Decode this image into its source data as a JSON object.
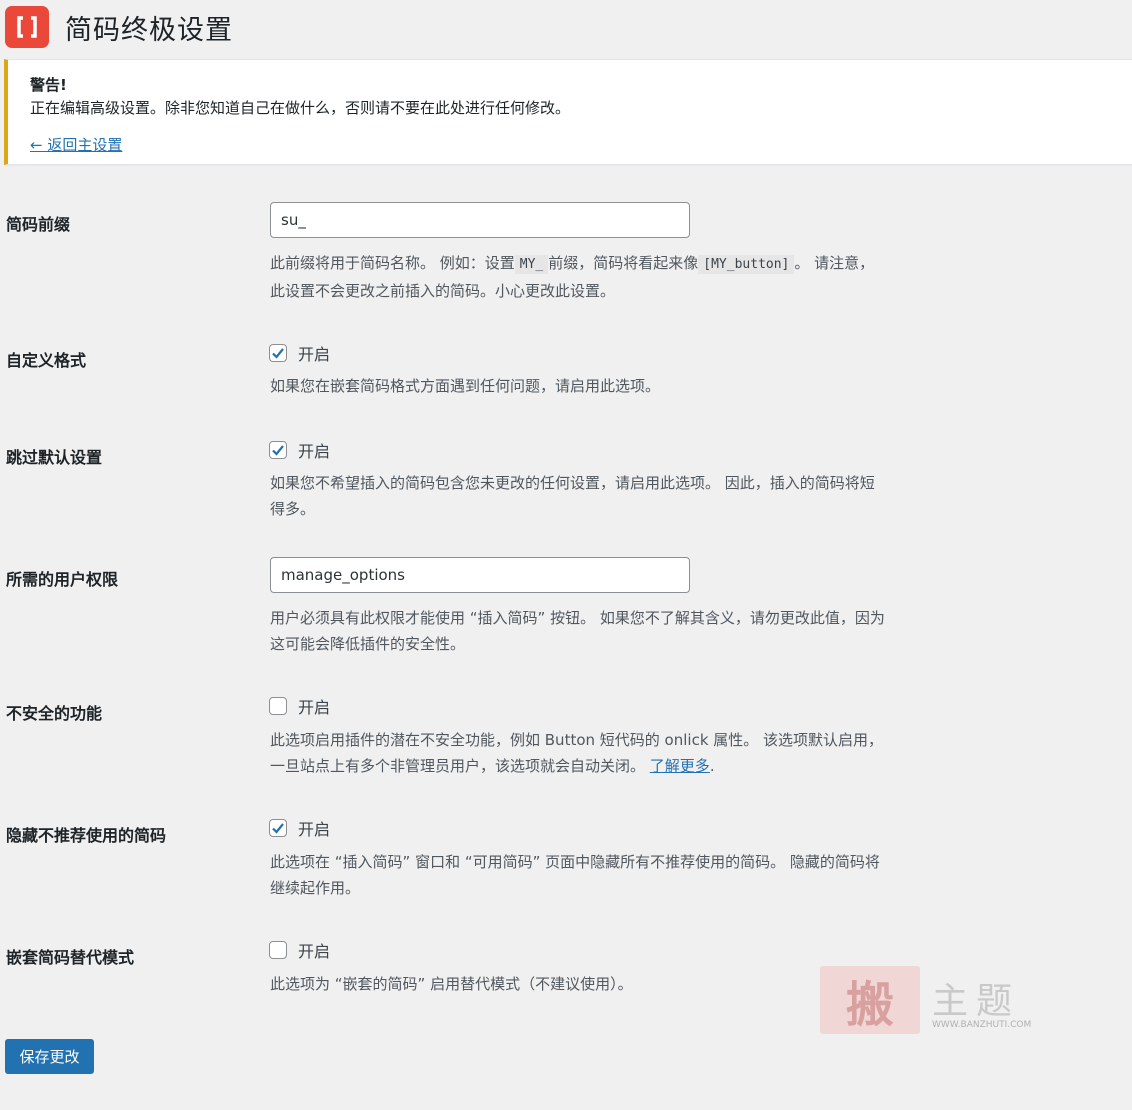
{
  "page": {
    "title": "简码终极设置"
  },
  "notice": {
    "title": "警告!",
    "text": "正在编辑高级设置。除非您知道自己在做什么，否则请不要在此处进行任何修改。",
    "back_link": "← 返回主设置"
  },
  "settings": {
    "prefix": {
      "label": "简码前缀",
      "value": "su_",
      "desc_1": "此前缀将用于简码名称。 例如：设置",
      "code_1": "MY_",
      "desc_2": "前缀，简码将看起来像",
      "code_2": "[MY_button]",
      "desc_3": "。 请注意，",
      "desc_line2": "此设置不会更改之前插入的简码。小心更改此设置。"
    },
    "custom_formatting": {
      "label": "自定义格式",
      "checked": true,
      "check_label": "开启",
      "desc": "如果您在嵌套简码格式方面遇到任何问题，请启用此选项。"
    },
    "skip_defaults": {
      "label": "跳过默认设置",
      "checked": true,
      "check_label": "开启",
      "desc_line1": "如果您不希望插入的简码包含您未更改的任何设置，请启用此选项。 因此，插入的简码将短",
      "desc_line2": "得多。"
    },
    "capability": {
      "label": "所需的用户权限",
      "value": "manage_options",
      "desc_line1": "用户必须具有此权限才能使用 “插入简码” 按钮。 如果您不了解其含义，请勿更改此值，因为",
      "desc_line2": "这可能会降低插件的安全性。"
    },
    "unsafe_features": {
      "label": "不安全的功能",
      "checked": false,
      "check_label": "开启",
      "desc_line1": "此选项启用插件的潜在不安全功能，例如 Button 短代码的 onlick 属性。 该选项默认启用，",
      "desc_line2": "一旦站点上有多个非管理员用户，该选项就会自动关闭。",
      "learn_more": "了解更多",
      "period": "."
    },
    "hide_deprecated": {
      "label": "隐藏不推荐使用的简码",
      "checked": true,
      "check_label": "开启",
      "desc_line1": "此选项在 “插入简码” 窗口和 “可用简码” 页面中隐藏所有不推荐使用的简码。 隐藏的简码将",
      "desc_line2": "继续起作用。"
    },
    "nested_alt_mode": {
      "label": "嵌套简码替代模式",
      "checked": false,
      "check_label": "开启",
      "desc": "此选项为 “嵌套的简码” 启用替代模式（不建议使用）。"
    }
  },
  "save_button": "保存更改",
  "watermark": {
    "seal": "搬",
    "text": "主题",
    "url": "WWW.BANZHUTI.COM"
  },
  "colors": {
    "primary": "#2271b1",
    "warning_border": "#dba617",
    "logo": "#ea4838"
  }
}
